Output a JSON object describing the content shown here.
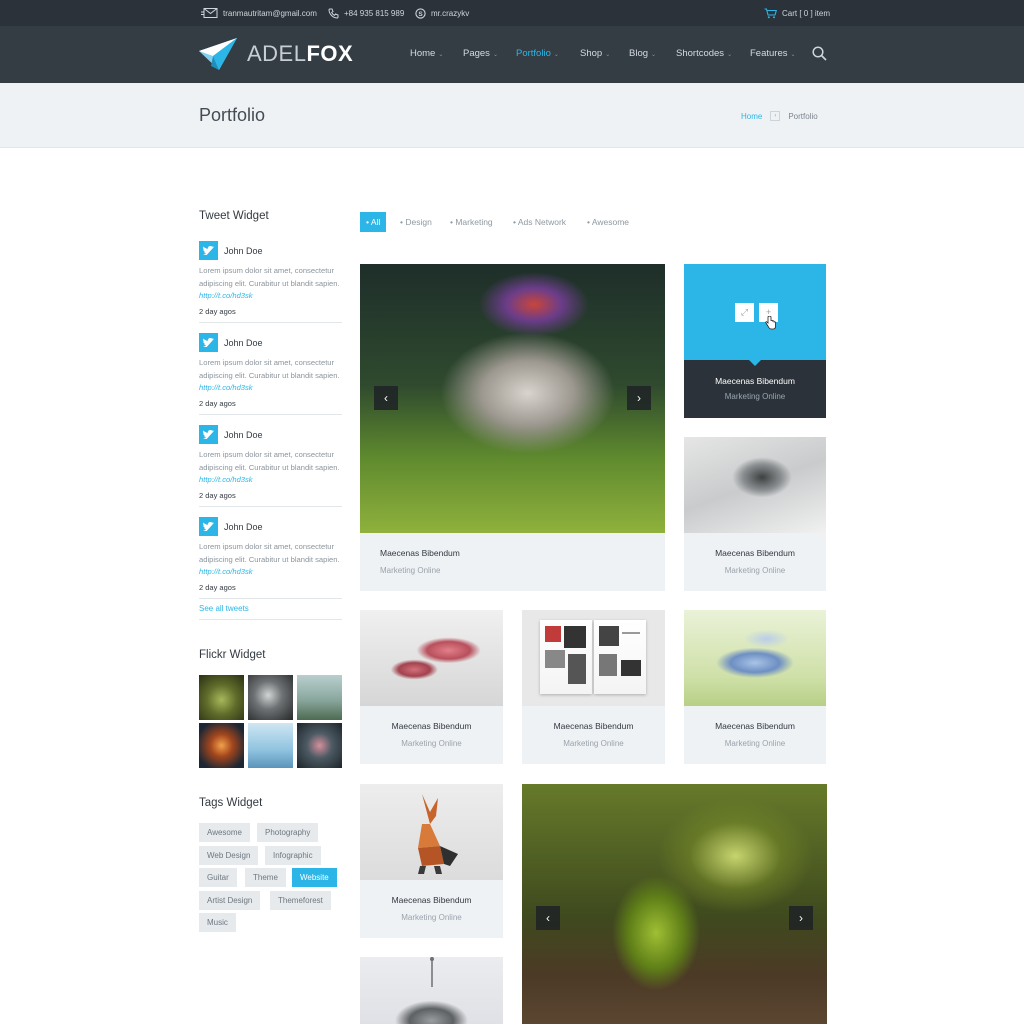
{
  "topbar": {
    "email": "tranmautritam@gmail.com",
    "phone": "+84 935 815 989",
    "skype": "mr.crazykv",
    "cart": "Cart [ 0 ] item"
  },
  "logo": {
    "prefix": "ADEL",
    "bold": "FOX"
  },
  "nav": [
    {
      "label": "Home"
    },
    {
      "label": "Pages"
    },
    {
      "label": "Portfolio"
    },
    {
      "label": "Shop"
    },
    {
      "label": "Blog"
    },
    {
      "label": "Shortcodes"
    },
    {
      "label": "Features"
    }
  ],
  "page": {
    "title": "Portfolio",
    "breadcrumb": {
      "home": "Home",
      "current": "Portfolio"
    }
  },
  "sidebar": {
    "tweet_widget_title": "Tweet Widget",
    "tweets": [
      {
        "name": "John Doe",
        "text": "Lorem ipsum dolor sit amet, consectetur adipiscing elit. Curabitur ut blandit sapien.",
        "link": "http://t.co/hd3sk",
        "time": "2 day agos"
      },
      {
        "name": "John Doe",
        "text": "Lorem ipsum dolor sit amet, consectetur adipiscing elit. Curabitur ut blandit sapien.",
        "link": "http://t.co/hd3sk",
        "time": "2 day agos"
      },
      {
        "name": "John Doe",
        "text": "Lorem ipsum dolor sit amet, consectetur adipiscing elit. Curabitur ut blandit sapien.",
        "link": "http://t.co/hd3sk",
        "time": "2 day agos"
      },
      {
        "name": "John Doe",
        "text": "Lorem ipsum dolor sit amet, consectetur adipiscing elit. Curabitur ut blandit sapien.",
        "link": "http://t.co/hd3sk",
        "time": "2 day agos"
      }
    ],
    "see_all": "See all tweets",
    "flickr_widget_title": "Flickr Widget",
    "tags_widget_title": "Tags Widget",
    "tags": [
      "Awesome",
      "Photography",
      "Web Design",
      "Infographic",
      "Guitar",
      "Theme",
      "Website",
      "Artist Design",
      "Themeforest",
      "Music"
    ],
    "active_tag": "Website"
  },
  "filters": [
    "• All",
    "• Design",
    "• Marketing",
    "• Ads Network",
    "• Awesome"
  ],
  "portfolio": {
    "item_title": "Maecenas Bibendum",
    "item_sub": "Marketing Online"
  },
  "colors": {
    "accent": "#2cb6e8",
    "topbar": "#2b3239",
    "header": "#343c44",
    "caption_bg": "#eef2f5"
  }
}
